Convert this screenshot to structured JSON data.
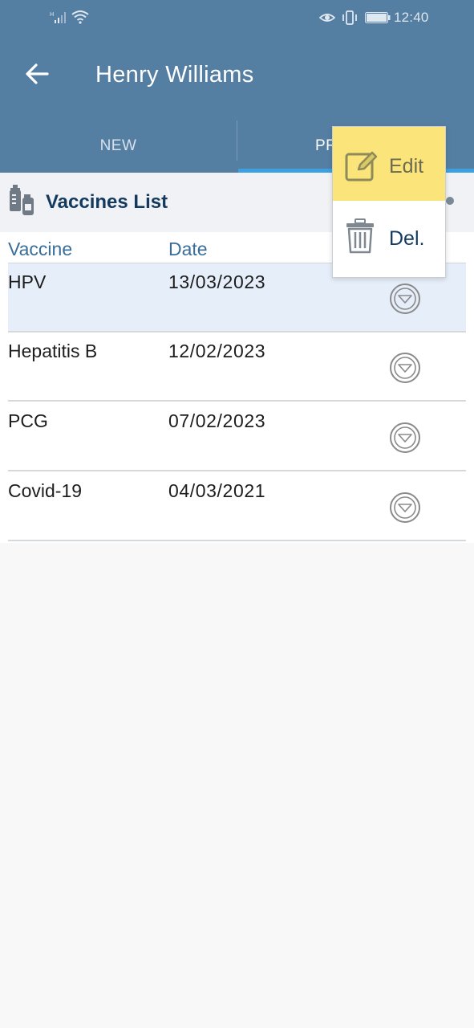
{
  "status_bar": {
    "time": "12:40"
  },
  "app_bar": {
    "title": "Henry Williams"
  },
  "tabs": [
    {
      "label": "NEW",
      "selected": false
    },
    {
      "label": "PR",
      "selected": true
    }
  ],
  "section": {
    "title": "Vaccines List"
  },
  "table": {
    "columns": [
      "Vaccine",
      "Date"
    ],
    "rows": [
      {
        "vaccine": "HPV",
        "date": "13/03/2023",
        "selected": true
      },
      {
        "vaccine": "Hepatitis B",
        "date": "12/02/2023",
        "selected": false
      },
      {
        "vaccine": "PCG",
        "date": "07/02/2023",
        "selected": false
      },
      {
        "vaccine": "Covid-19",
        "date": "04/03/2021",
        "selected": false
      }
    ]
  },
  "popup_menu": {
    "items": [
      {
        "label": "Edit",
        "icon": "edit-icon",
        "highlighted": true
      },
      {
        "label": "Del.",
        "icon": "trash-icon",
        "highlighted": false
      }
    ]
  },
  "colors": {
    "header": "#557ea3",
    "tab_indicator": "#3ea0e0",
    "section_title": "#133a5e",
    "column_header": "#3a6e99",
    "selected_row": "#e6eefa",
    "highlight": "#fbe57a"
  }
}
